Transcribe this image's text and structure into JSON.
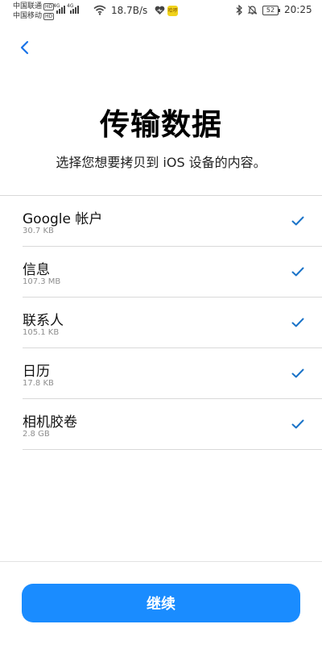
{
  "status_bar": {
    "carrier_1": "中国联通",
    "carrier_2": "中国移动",
    "hd_badge": "HD",
    "network_tag": "4G",
    "net_speed": "18.7B/s",
    "app_badge": "哈啰",
    "battery": "52",
    "time": "20:25",
    "icons": [
      "signal-icon",
      "wifi-icon",
      "heart-icon",
      "bluetooth-icon",
      "mute-icon",
      "battery-icon"
    ]
  },
  "header": {
    "back_icon": "chevron-left-icon",
    "title": "传输数据",
    "subtitle": "选择您想要拷贝到 iOS 设备的内容。"
  },
  "items": [
    {
      "title": "Google 帐户",
      "size": "30.7 KB",
      "checked": true
    },
    {
      "title": "信息",
      "size": "107.3 MB",
      "checked": true
    },
    {
      "title": "联系人",
      "size": "105.1 KB",
      "checked": true
    },
    {
      "title": "日历",
      "size": "17.8 KB",
      "checked": true
    },
    {
      "title": "相机胶卷",
      "size": "2.8 GB",
      "checked": true
    }
  ],
  "footer": {
    "continue_label": "继续"
  },
  "colors": {
    "accent": "#1a8cff",
    "check": "#1a73c8",
    "divider": "#d9d9d9"
  }
}
